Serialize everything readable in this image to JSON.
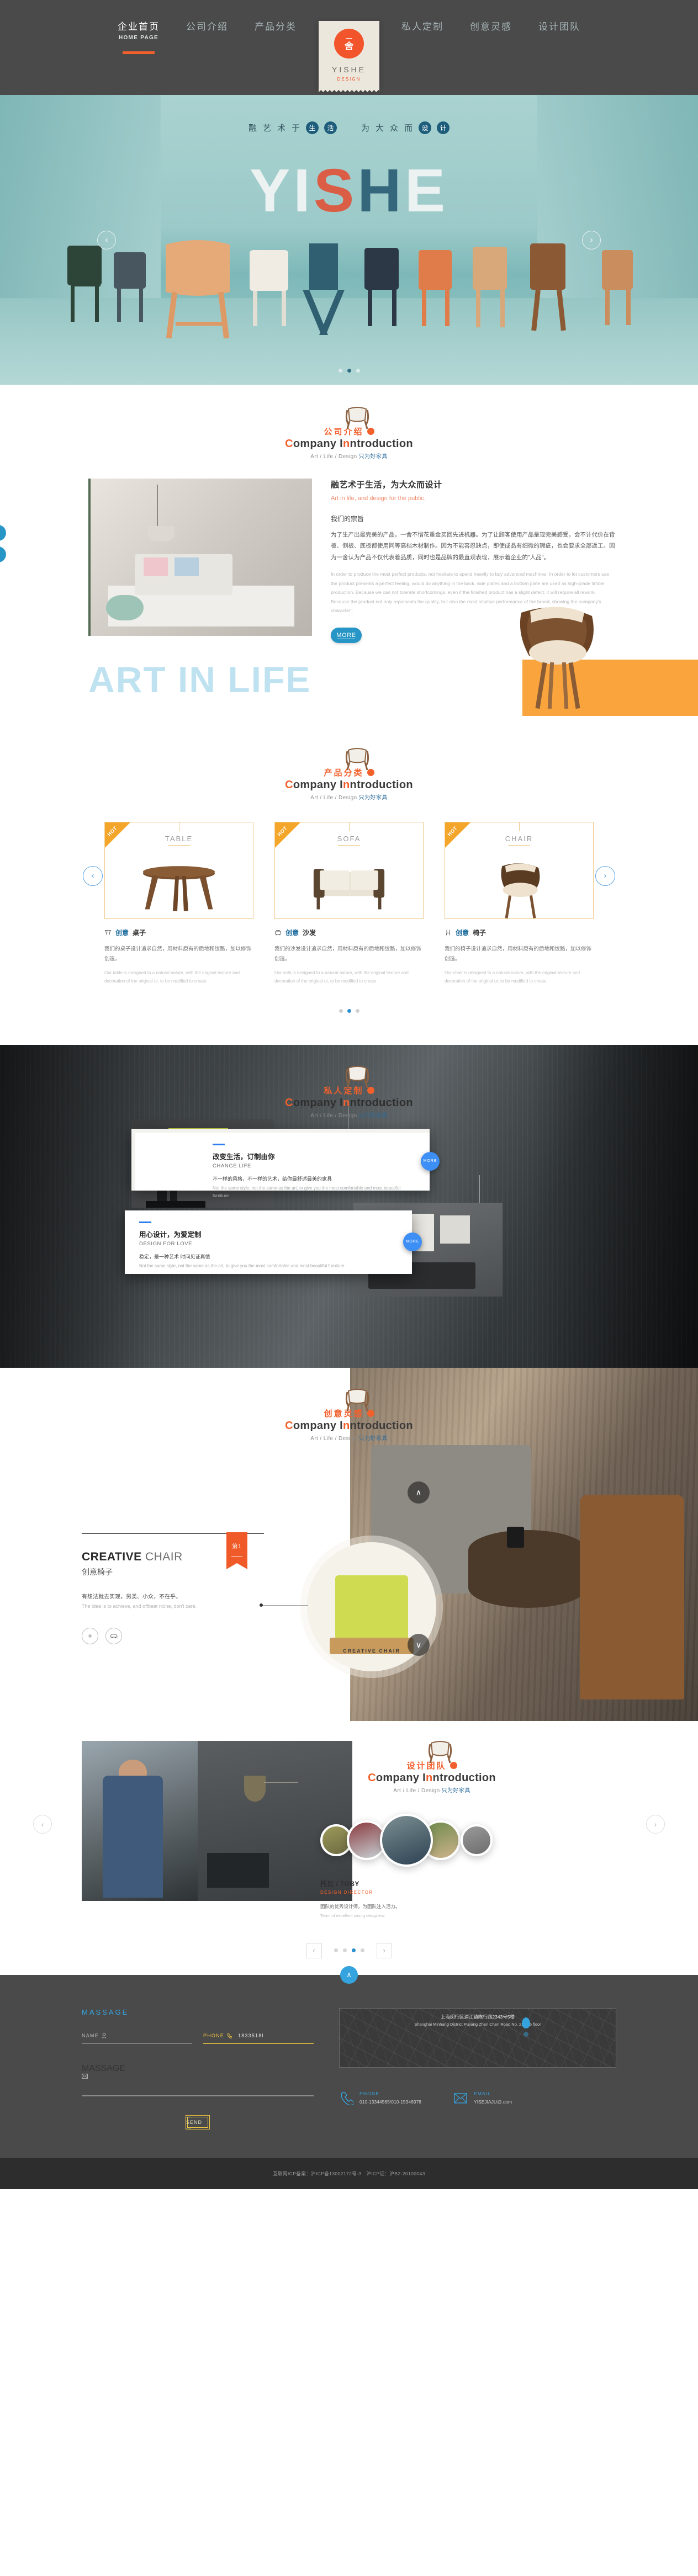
{
  "nav": {
    "logo": {
      "seal_top": "一",
      "seal_bottom": "舍",
      "brand": "YISHE",
      "sub": "DESIGN"
    },
    "left_items": [
      {
        "cn": "企业首页",
        "en": "HOME PAGE",
        "active": true
      },
      {
        "cn": "公司介绍",
        "en": "",
        "active": false
      },
      {
        "cn": "产品分类",
        "en": "",
        "active": false
      }
    ],
    "right_items": [
      {
        "cn": "私人定制",
        "en": "",
        "active": false
      },
      {
        "cn": "创意灵感",
        "en": "",
        "active": false
      },
      {
        "cn": "设计团队",
        "en": "",
        "active": false
      }
    ]
  },
  "hero": {
    "slogan_left": {
      "plain": [
        "融",
        "艺",
        "术",
        "于"
      ],
      "badges": [
        "生",
        "活"
      ]
    },
    "slogan_right": {
      "plain": [
        "为",
        "大",
        "众",
        "而"
      ],
      "badges": [
        "设",
        "计"
      ]
    },
    "word": [
      "Y",
      "I",
      "S",
      "H",
      "E"
    ],
    "prev": "‹",
    "next": "›",
    "dots": 3,
    "active_dot": 1
  },
  "company": {
    "header": {
      "cn": "公司介绍",
      "en": "Company Introduction",
      "en_first": "C",
      "en_rest": "ompany I",
      "en_tail": "ntroduction",
      "tag_left": "Art / Life / Design",
      "tag_right": "只为好家具"
    },
    "title": "融艺术于生活，为大众而设计",
    "subtitle_en": "Art in life, and design for the public.",
    "heading": "我们的宗旨",
    "paragraph_cn": "为了生产出最完美的产品，一舍不惜花重金买回先进机器。为了让顾客使用产品呈现完美感受，会不计代价在背板、侧板、底板都使用同等高档木材制作。因为不能容忍缺点，即使成品有细微的瑕疵，也会要求全部返工。因为一舍认为产品不仅代表着品质，同时也是品牌的最直观表现，展示着企业的\"人品\"。",
    "paragraph_en": "In order to produce the most perfect products, not hesitate to spend heavily to buy advanced machines. In order to let customers use the product presents a perfect feeling, would do anything in the back, side plates and a bottom plate are used as high-grade timber production. Because we can not tolerate shortcomings, even if the finished product has a slight defect, it will require all rework. Because the product not only represents the quality, but also the most intuitive performance of the brand, showing the company's character\".",
    "more_label": "MORE",
    "side_up": "∧",
    "side_down": "∨",
    "art_text": "ART IN LIFE"
  },
  "products": {
    "header": {
      "cn": "产品分类",
      "en_first": "C",
      "en_rest": "ompany I",
      "en_tail": "ntroduction",
      "tag_left": "Art / Life / Design",
      "tag_right": "只为好家具"
    },
    "badge": "HOT",
    "items": [
      {
        "name": "TABLE",
        "icon": "table-icon",
        "title_blue": "创意",
        "title_dark": "桌子",
        "desc_cn": "我们的桌子设计追求自然，用材料原有的质地和纹路，加以修饰创造。",
        "desc_en": "Our table is designed to a natural nature, with the original texture and decoration of the original ur, to be modified to create."
      },
      {
        "name": "SOFA",
        "icon": "sofa-icon",
        "title_blue": "创意",
        "title_dark": "沙发",
        "desc_cn": "我们的沙发设计追求自然，用材料原有的质地和纹路，加以修饰创造。",
        "desc_en": "Our sofa is designed to a natural nature, with the original texture and decoration of the original ur, to be modified to create."
      },
      {
        "name": "CHAIR",
        "icon": "chair-icon",
        "title_blue": "创意",
        "title_dark": "椅子",
        "desc_cn": "我们的椅子设计追求自然，用材料原有的质地和纹路，加以修饰创造。",
        "desc_en": "Our chair is designed to a natural nature, with the original texture and decoration of the original ur, to be modified to create."
      }
    ],
    "prev": "‹",
    "next": "›",
    "dots": 3,
    "active_dot": 1
  },
  "custom": {
    "header": {
      "cn": "私人定制",
      "en_first": "C",
      "en_rest": "ompany I",
      "en_tail": "ntroduction",
      "tag_left": "Art / Life / Design",
      "tag_right": "只为好家具"
    },
    "panels": [
      {
        "title_cn": "改变生活，订制由你",
        "title_en": "CHANGE LIFE",
        "desc_cn": "不一样的风格，不一样的艺术，给你最舒适最美的家具",
        "desc_en": "Not the same style, not the same as the art, to give you the most comfortable and most beautiful furniture",
        "more": "MORE"
      },
      {
        "title_cn": "用心设计，为爱定制",
        "title_en": "DESIGN FOR LOVE",
        "desc_cn": "稳定，是一种艺术 时间见证真情",
        "desc_en": "Not the same style, not the same as the art, to give you the most comfortable and most beautiful furniture",
        "more": "MORE"
      }
    ]
  },
  "creative": {
    "header": {
      "cn": "创意灵感",
      "en_first": "C",
      "en_rest": "ompany I",
      "en_tail": "ntroduction",
      "tag_left": "Art / Life / Design",
      "tag_right": "只为好家具"
    },
    "ribbon": "第1",
    "title_bold": "CREATIVE",
    "title_light": "CHAIR",
    "title_cn": "创意椅子",
    "desc_cn": "有想法就去实现，另类、小众，不在乎。",
    "desc_en": "The idea is to achieve, and offbeat niche, don't care.",
    "icons": [
      "plus-icon",
      "car-icon"
    ],
    "circle_label": "CREATIVE CHAIR",
    "up": "∧",
    "down": "∨"
  },
  "team": {
    "header": {
      "cn": "设计团队",
      "en_first": "C",
      "en_rest": "ompany I",
      "en_tail": "ntroduction",
      "tag_left": "Art / Life / Design",
      "tag_right": "只为好家具"
    },
    "designer_name": "托比 / TOBY",
    "designer_role": "DESIGN DIRECTOR",
    "designer_cn": "团队的优秀设计师，为团队注入活力。",
    "designer_en": "Team of excellent young designers.",
    "prev": "‹",
    "next": "›",
    "dots": 4,
    "active_dot": 2,
    "nav_left": "‹",
    "nav_right": "›"
  },
  "footer": {
    "to_top": "∧",
    "form_title": "MASSAGE",
    "name_label": "NAME",
    "name_icon": "person-icon",
    "name_value": "",
    "phone_label": "PHONE",
    "phone_icon": "phone-icon",
    "phone_value": "1833518l",
    "massage_label": "MASSAGE",
    "massage_icon": "mail-icon",
    "massage_value": "",
    "send_label": "— SEND —",
    "map": {
      "address_cn": "上海闵行区浦江镇陈行路2343号5楼",
      "address_en": "Shanghai Minhang District Pujiang Zhen Chen Road No. 2343 5 floor",
      "pin": "map-pin-icon"
    },
    "contacts": [
      {
        "icon": "phone-icon",
        "key": "PHONE",
        "value": "010-13344565/010-15346978"
      },
      {
        "icon": "email-icon",
        "key": "EMAIL",
        "value": "YISEJIAJU@.com"
      }
    ],
    "copyright": "互联网ICP备案：沪ICP备13002172号-3　沪ICP证：沪B2-20100043"
  }
}
